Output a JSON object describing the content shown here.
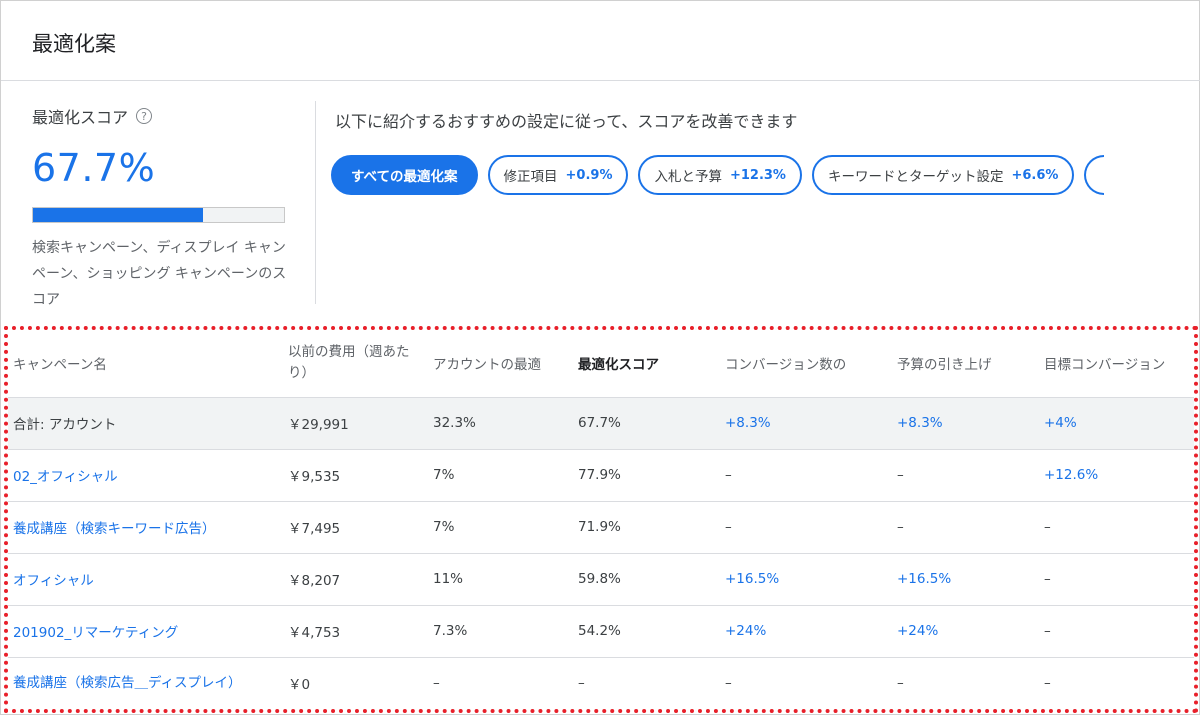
{
  "page_title": "最適化案",
  "score": {
    "label": "最適化スコア",
    "help_icon": "?",
    "value": "67.7%",
    "progress_fraction": 0.677,
    "description": "検索キャンペーン、ディスプレイ キャンペーン、ショッピング キャンペーンのスコア"
  },
  "recommendations": {
    "intro": "以下に紹介するおすすめの設定に従って、スコアを改善できます",
    "chips": [
      {
        "label": "すべての最適化案",
        "delta": "",
        "active": true
      },
      {
        "label": "修正項目",
        "delta": "+0.9%",
        "active": false
      },
      {
        "label": "入札と予算",
        "delta": "+12.3%",
        "active": false
      },
      {
        "label": "キーワードとターゲット設定",
        "delta": "+6.6%",
        "active": false
      }
    ]
  },
  "table": {
    "headers": [
      "キャンペーン名",
      "以前の費用（週あたり）",
      "アカウントの最適",
      "最適化スコア",
      "コンバージョン数の",
      "予算の引き上げ",
      "目標コンバージョン"
    ],
    "rows": [
      {
        "name": "合計: アカウント",
        "cost": "￥29,991",
        "account": "32.3%",
        "score": "67.7%",
        "conv": "+8.3%",
        "budget": "+8.3%",
        "target": "+4%"
      },
      {
        "name": "02_オフィシャル",
        "cost": "￥9,535",
        "account": "7%",
        "score": "77.9%",
        "conv": "–",
        "budget": "–",
        "target": "+12.6%"
      },
      {
        "name": "養成講座（検索キーワード広告）",
        "cost": "￥7,495",
        "account": "7%",
        "score": "71.9%",
        "conv": "–",
        "budget": "–",
        "target": "–"
      },
      {
        "name": "オフィシャル",
        "cost": "￥8,207",
        "account": "11%",
        "score": "59.8%",
        "conv": "+16.5%",
        "budget": "+16.5%",
        "target": "–"
      },
      {
        "name": "201902_リマーケティング",
        "cost": "￥4,753",
        "account": "7.3%",
        "score": "54.2%",
        "conv": "+24%",
        "budget": "+24%",
        "target": "–"
      },
      {
        "name": "養成講座（検索広告＿ディスプレイ）",
        "cost": "￥0",
        "account": "–",
        "score": "–",
        "conv": "–",
        "budget": "–",
        "target": "–"
      }
    ]
  },
  "colors": {
    "accent": "#1a73e8",
    "highlight_border": "#e8202a",
    "total_row_bg": "#f1f3f4"
  }
}
